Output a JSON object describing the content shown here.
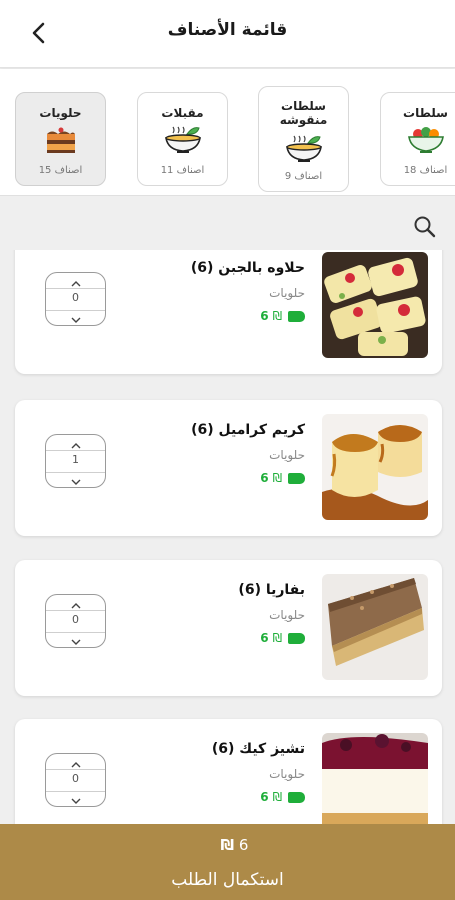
{
  "header": {
    "title": "قائمة الأصناف"
  },
  "categories": [
    {
      "name": "حلويات",
      "count": "15 اصناف",
      "icon": "cake-icon"
    },
    {
      "name": "مقبلات",
      "count": "11 اصناف",
      "icon": "soup-bowl-icon"
    },
    {
      "name": "سلطات منقوشه",
      "count": "9 اصناف",
      "icon": "soup-bowl-icon"
    },
    {
      "name": "سلطات",
      "count": "18 اصناف",
      "icon": "salad-bowl-icon"
    }
  ],
  "products": [
    {
      "name": "حلاوه بالجبن (6)",
      "category": "حلويات",
      "price": "6",
      "currency": "₪",
      "qty": "0"
    },
    {
      "name": "كريم كراميل (6)",
      "category": "حلويات",
      "price": "6",
      "currency": "₪",
      "qty": "1"
    },
    {
      "name": "بفاريا (6)",
      "category": "حلويات",
      "price": "6",
      "currency": "₪",
      "qty": "0"
    },
    {
      "name": "تشيز كيك (6)",
      "category": "حلويات",
      "price": "6",
      "currency": "₪",
      "qty": "0"
    }
  ],
  "footer": {
    "total": "6",
    "currency": "₪",
    "checkout_label": "استكمال الطلب"
  },
  "colors": {
    "accent": "#ad8a48",
    "price_green": "#1fae3a"
  }
}
